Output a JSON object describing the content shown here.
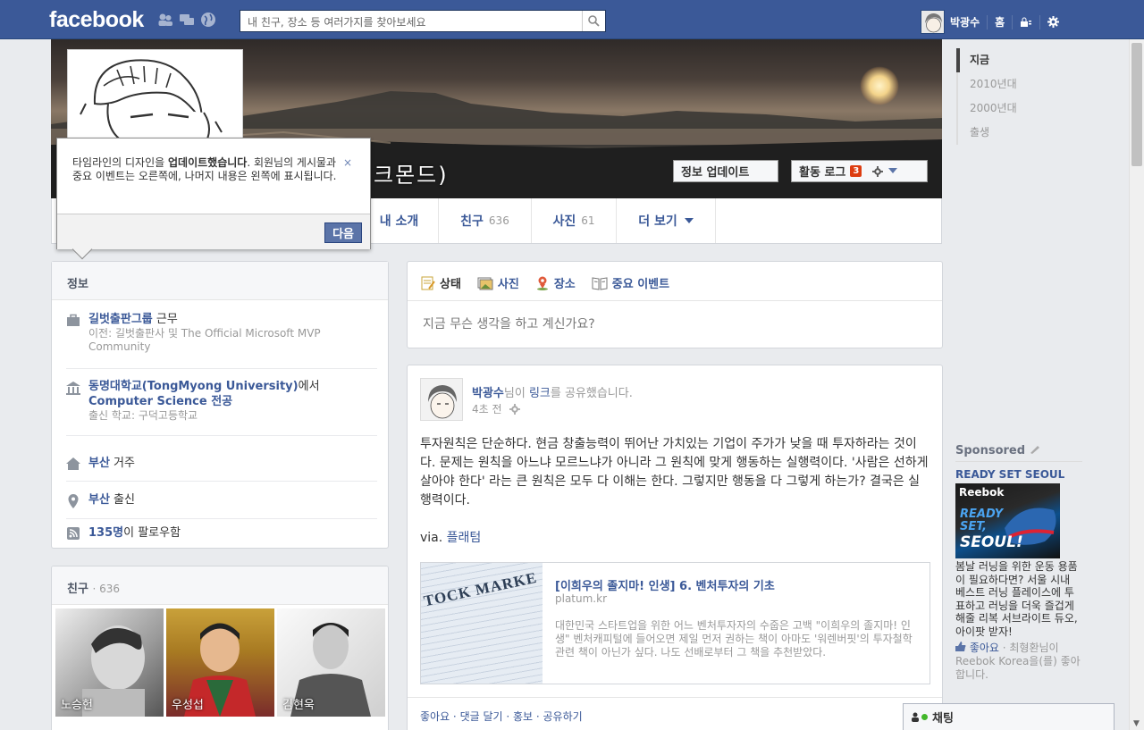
{
  "topbar": {
    "logo": "facebook",
    "search_placeholder": "내 친구, 장소 등 여러가지를 찾아보세요",
    "user_name": "박광수",
    "home": "홈"
  },
  "cover": {
    "name_tail": "크몬드)",
    "update_info": "정보 업데이트",
    "activity_log": "활동 로그",
    "activity_badge": "3"
  },
  "nav": {
    "about": "내 소개",
    "friends": "친구",
    "friends_count": "636",
    "photos": "사진",
    "photos_count": "61",
    "more": "더 보기"
  },
  "tooltip": {
    "text_pre": "타임라인의 디자인을 ",
    "text_bold": "업데이트했습니다",
    "text_post": ". 회원님의 게시물과 중요 이벤트는 오른쪽에, 나머지 내용은 왼쪽에 표시됩니다.",
    "close": "×",
    "next": "다음"
  },
  "info": {
    "title": "정보",
    "work_main": "길벗출판그룹",
    "work_suffix": " 근무",
    "work_prev": "이전: 길벗출판사 및 The Official Microsoft MVP Community",
    "edu_main": "동명대학교(TongMyong University)",
    "edu_suffix": "에서",
    "edu_major": "Computer Science 전공",
    "edu_hs": "출신 학교: 구덕고등학교",
    "lives_main": "부산",
    "lives_suffix": " 거주",
    "from_main": "부산",
    "from_suffix": " 출신",
    "followers_main": "135명",
    "followers_suffix": "이 팔로우함"
  },
  "friends_box": {
    "title": "친구",
    "count": "· 636",
    "items": [
      {
        "name": "노승헌"
      },
      {
        "name": "우성섭"
      },
      {
        "name": "김현욱"
      }
    ]
  },
  "composer": {
    "tabs": [
      "상태",
      "사진",
      "장소",
      "중요 이벤트"
    ],
    "placeholder": "지금 무슨 생각을 하고 계신가요?"
  },
  "post": {
    "author": "박광수",
    "action_pre": "님이 ",
    "action_link": "링크",
    "action_post": "를 공유했습니다.",
    "time": "4초 전",
    "body": "투자원칙은 단순하다. 현금 창출능력이 뛰어난 가치있는 기업이 주가가 낮을 때 투자하라는 것이다. 문제는 원칙을 아느냐 모르느냐가 아니라 그 원칙에 맞게 행동하는 실행력이다. '사람은 선하게 살아야 한다' 라는 큰 원칙은 모두 다 이해는 한다. 그렇지만 행동을 다 그렇게 하는가? 결국은 실행력이다.",
    "via_label": "via.",
    "via_link": "플래텀",
    "card_title": "[이희우의 졸지마! 인생] 6. 벤처투자의 기초",
    "card_domain": "platum.kr",
    "card_desc": "대한민국 스타트업을 위한 어느 벤처투자자의 수줍은 고백 \"이희우의 졸지마! 인생\" 벤처캐피털에 들어오면 제일 먼저 권하는 책이 아마도 '워렌버핏'의 투자철학 관련 책이 아닌가 싶다. 나도 선배로부터 그 책을 추천받았다.",
    "card_thumb_text": "TOCK MARKE",
    "actions": "좋아요 · 댓글 달기 · 홍보 · 공유하기"
  },
  "timeline_nav": [
    "지금",
    "2010년대",
    "2000년대",
    "출생"
  ],
  "sponsored": {
    "header": "Sponsored",
    "title": "READY SET SEOUL",
    "img_brand": "Reebok",
    "img_line1": "READY",
    "img_line2": "SET,",
    "img_line3": "SEOUL!",
    "desc": "봄날 러닝을 위한 운동 용품이 필요하다면? 서울 시내 베스트 러닝 플레이스에 투표하고 러닝을 더욱 즐겁게 해줄 리복 서브라이트 듀오, 아이팟 받자!",
    "like_label": "좋아요",
    "like_text": " · 최형환님이 Reebok Korea을(를) 좋아합니다."
  },
  "chat": {
    "label": "채팅"
  },
  "colors": {
    "brand": "#3b5998",
    "background": "#e9ebee",
    "badge": "#dd3c10",
    "link_blue": "#3b5998"
  }
}
